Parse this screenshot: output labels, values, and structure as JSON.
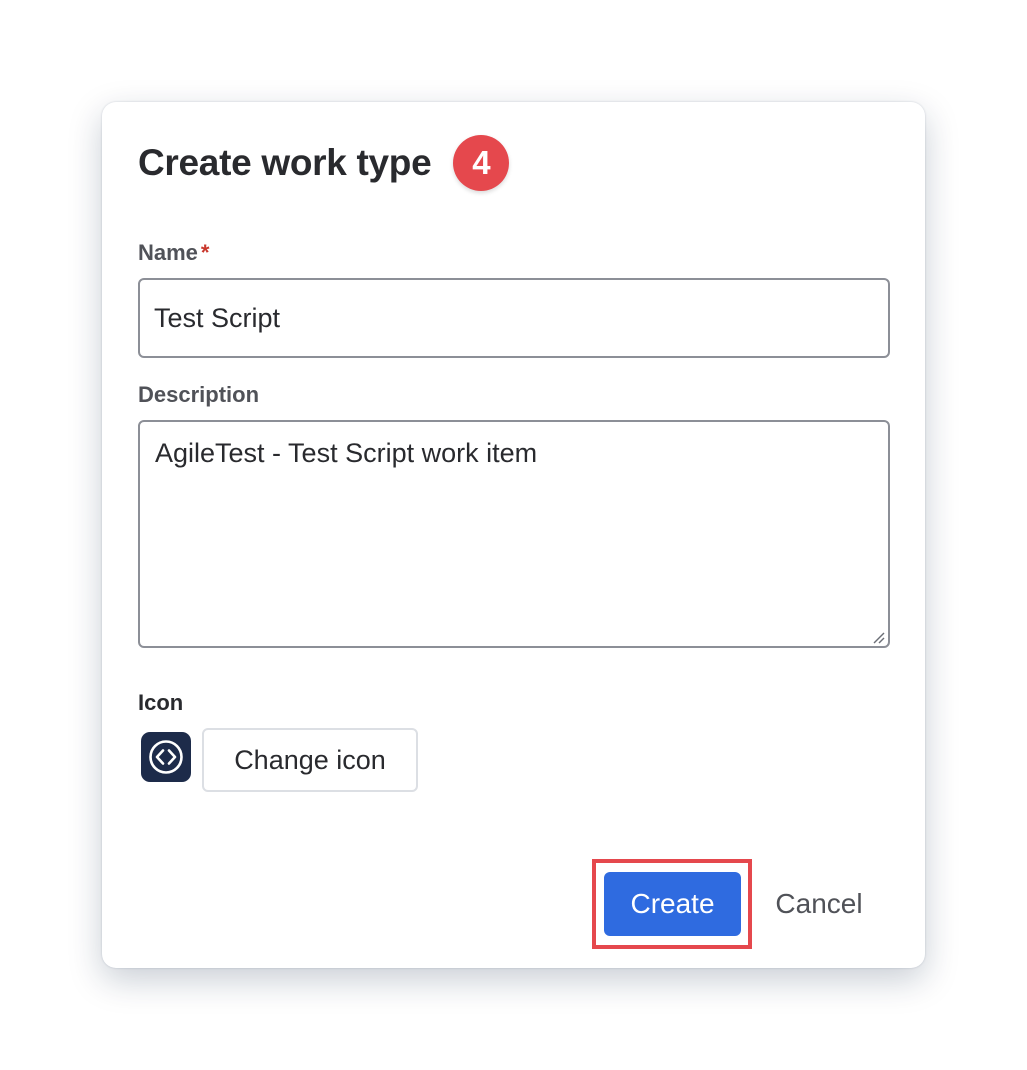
{
  "dialog": {
    "title": "Create work type",
    "step_badge": "4"
  },
  "form": {
    "name": {
      "label": "Name",
      "required_marker": "*",
      "value": "Test Script"
    },
    "description": {
      "label": "Description",
      "value": "AgileTest - Test Script work item"
    },
    "icon": {
      "label": "Icon",
      "icon_name": "code-brackets-icon",
      "change_label": "Change icon"
    }
  },
  "actions": {
    "create_label": "Create",
    "cancel_label": "Cancel"
  },
  "colors": {
    "primary": "#2f6be0",
    "badge": "#e5484d",
    "highlight": "#e5484d",
    "icon_tile": "#1d2b4a"
  }
}
